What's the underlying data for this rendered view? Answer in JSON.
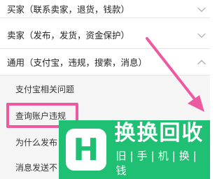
{
  "list": {
    "items": [
      {
        "label": "买家（联系卖家，退货，钱款）",
        "expanded": false
      },
      {
        "label": "卖家（发布，发货，资金保护）",
        "expanded": false
      },
      {
        "label": "通用（支付宝，违规，搜索，消息）",
        "expanded": true
      }
    ],
    "subitems": [
      {
        "label": "支付宝相关问题"
      },
      {
        "label": "查询账户违规"
      },
      {
        "label": "为什么发布"
      },
      {
        "label": "消息发送不"
      }
    ]
  },
  "watermark": {
    "logo_letter": "H",
    "title": "换换回收",
    "subtitle": [
      "旧",
      "手",
      "机",
      "换",
      "钱"
    ]
  },
  "colors": {
    "highlight": "#ee5aa0",
    "watermark_bg": "#1fc073",
    "arrow": "#ee5aa0"
  }
}
